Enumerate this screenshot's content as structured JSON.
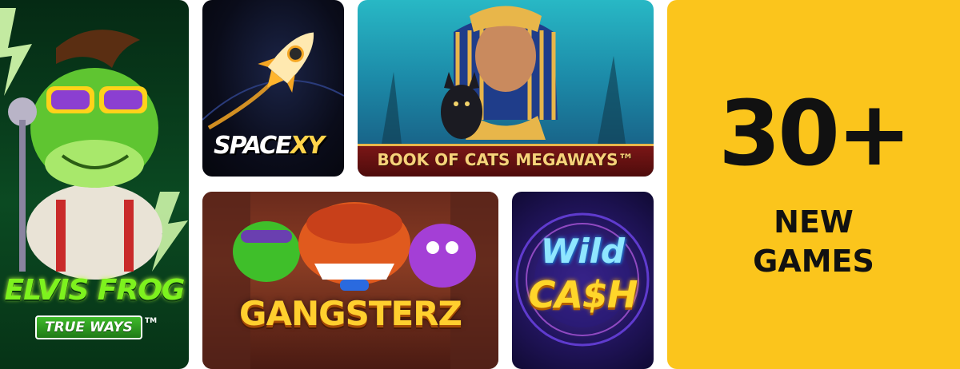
{
  "tiles": {
    "elvis_frog": {
      "title": "ELVIS FROG",
      "subtitle": "TRUE WAYS",
      "trademark": "TM"
    },
    "space_xy": {
      "title_part1": "SPACE",
      "title_part2": "XY"
    },
    "book_of_cats": {
      "title": "BOOK OF CATS MEGAWAYS™"
    },
    "gangsterz": {
      "title": "GANGSTERZ"
    },
    "wild_cash": {
      "title_line1": "Wild",
      "title_line2": "CA$H"
    }
  },
  "promo": {
    "count": "30+",
    "line1": "NEW",
    "line2": "GAMES"
  },
  "colors": {
    "promo_bg": "#fbc51c",
    "elvis_green": "#7df21e",
    "gold": "#ffcf2e"
  }
}
